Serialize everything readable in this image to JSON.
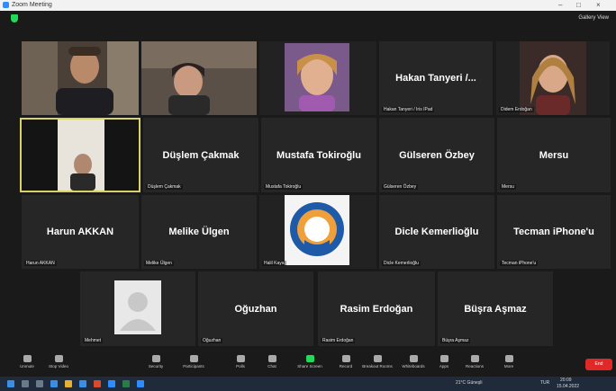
{
  "window": {
    "title": "Zoom Meeting",
    "view_label": "Gallery View"
  },
  "participants": [
    {
      "name": "",
      "label": ""
    },
    {
      "name": "",
      "label": ""
    },
    {
      "name": "",
      "label": ""
    },
    {
      "name": "Hakan Tanyeri /...",
      "label": "Hakan Tanyeri / Iris IPad"
    },
    {
      "name": "",
      "label": "Didem Erdoğan"
    },
    {
      "name": "",
      "label": ""
    },
    {
      "name": "Düşlem Çakmak",
      "label": "Düşlem Çakmak"
    },
    {
      "name": "Mustafa Tokiroğlu",
      "label": "Mustafa Tokiroğlu"
    },
    {
      "name": "Gülseren Özbey",
      "label": "Gülseren Özbey"
    },
    {
      "name": "Mersu",
      "label": "Mersu"
    },
    {
      "name": "Harun AKKAN",
      "label": "Harun AKKAN"
    },
    {
      "name": "Melike Ülgen",
      "label": "Melike Ülgen"
    },
    {
      "name": "",
      "label": "Halil Kaya"
    },
    {
      "name": "Dicle Kemerlioğlu",
      "label": "Dicle Kemerlioğlu"
    },
    {
      "name": "Tecman iPhone'u",
      "label": "Tecman iPhone'u"
    },
    {
      "name": "",
      "label": "Mehmet"
    },
    {
      "name": "Oğuzhan",
      "label": "Oğuzhan"
    },
    {
      "name": "Rasim Erdoğan",
      "label": "Rasim Erdoğan"
    },
    {
      "name": "Büşra Aşmaz",
      "label": "Büşra Aşmaz"
    }
  ],
  "toolbar": {
    "unmute": "Unmute",
    "stop_video": "Stop Video",
    "security": "Security",
    "participants": "Participants",
    "participants_count": "19",
    "polls": "Polls",
    "chat": "Chat",
    "share_screen": "Share Screen",
    "record": "Record",
    "breakout": "Breakout Rooms",
    "whiteboards": "Whiteboards",
    "apps": "Apps",
    "reactions": "Reactions",
    "more": "More",
    "end": "End"
  },
  "taskbar": {
    "weather": "21°C Güneşli",
    "time": "20:09",
    "date": "15.04.2022",
    "lang": "TUR"
  },
  "colors": {
    "accent_green": "#23d959",
    "end_red": "#e02828",
    "active_border": "#d9d266",
    "taskbar_bg": "#1f2a3a"
  }
}
